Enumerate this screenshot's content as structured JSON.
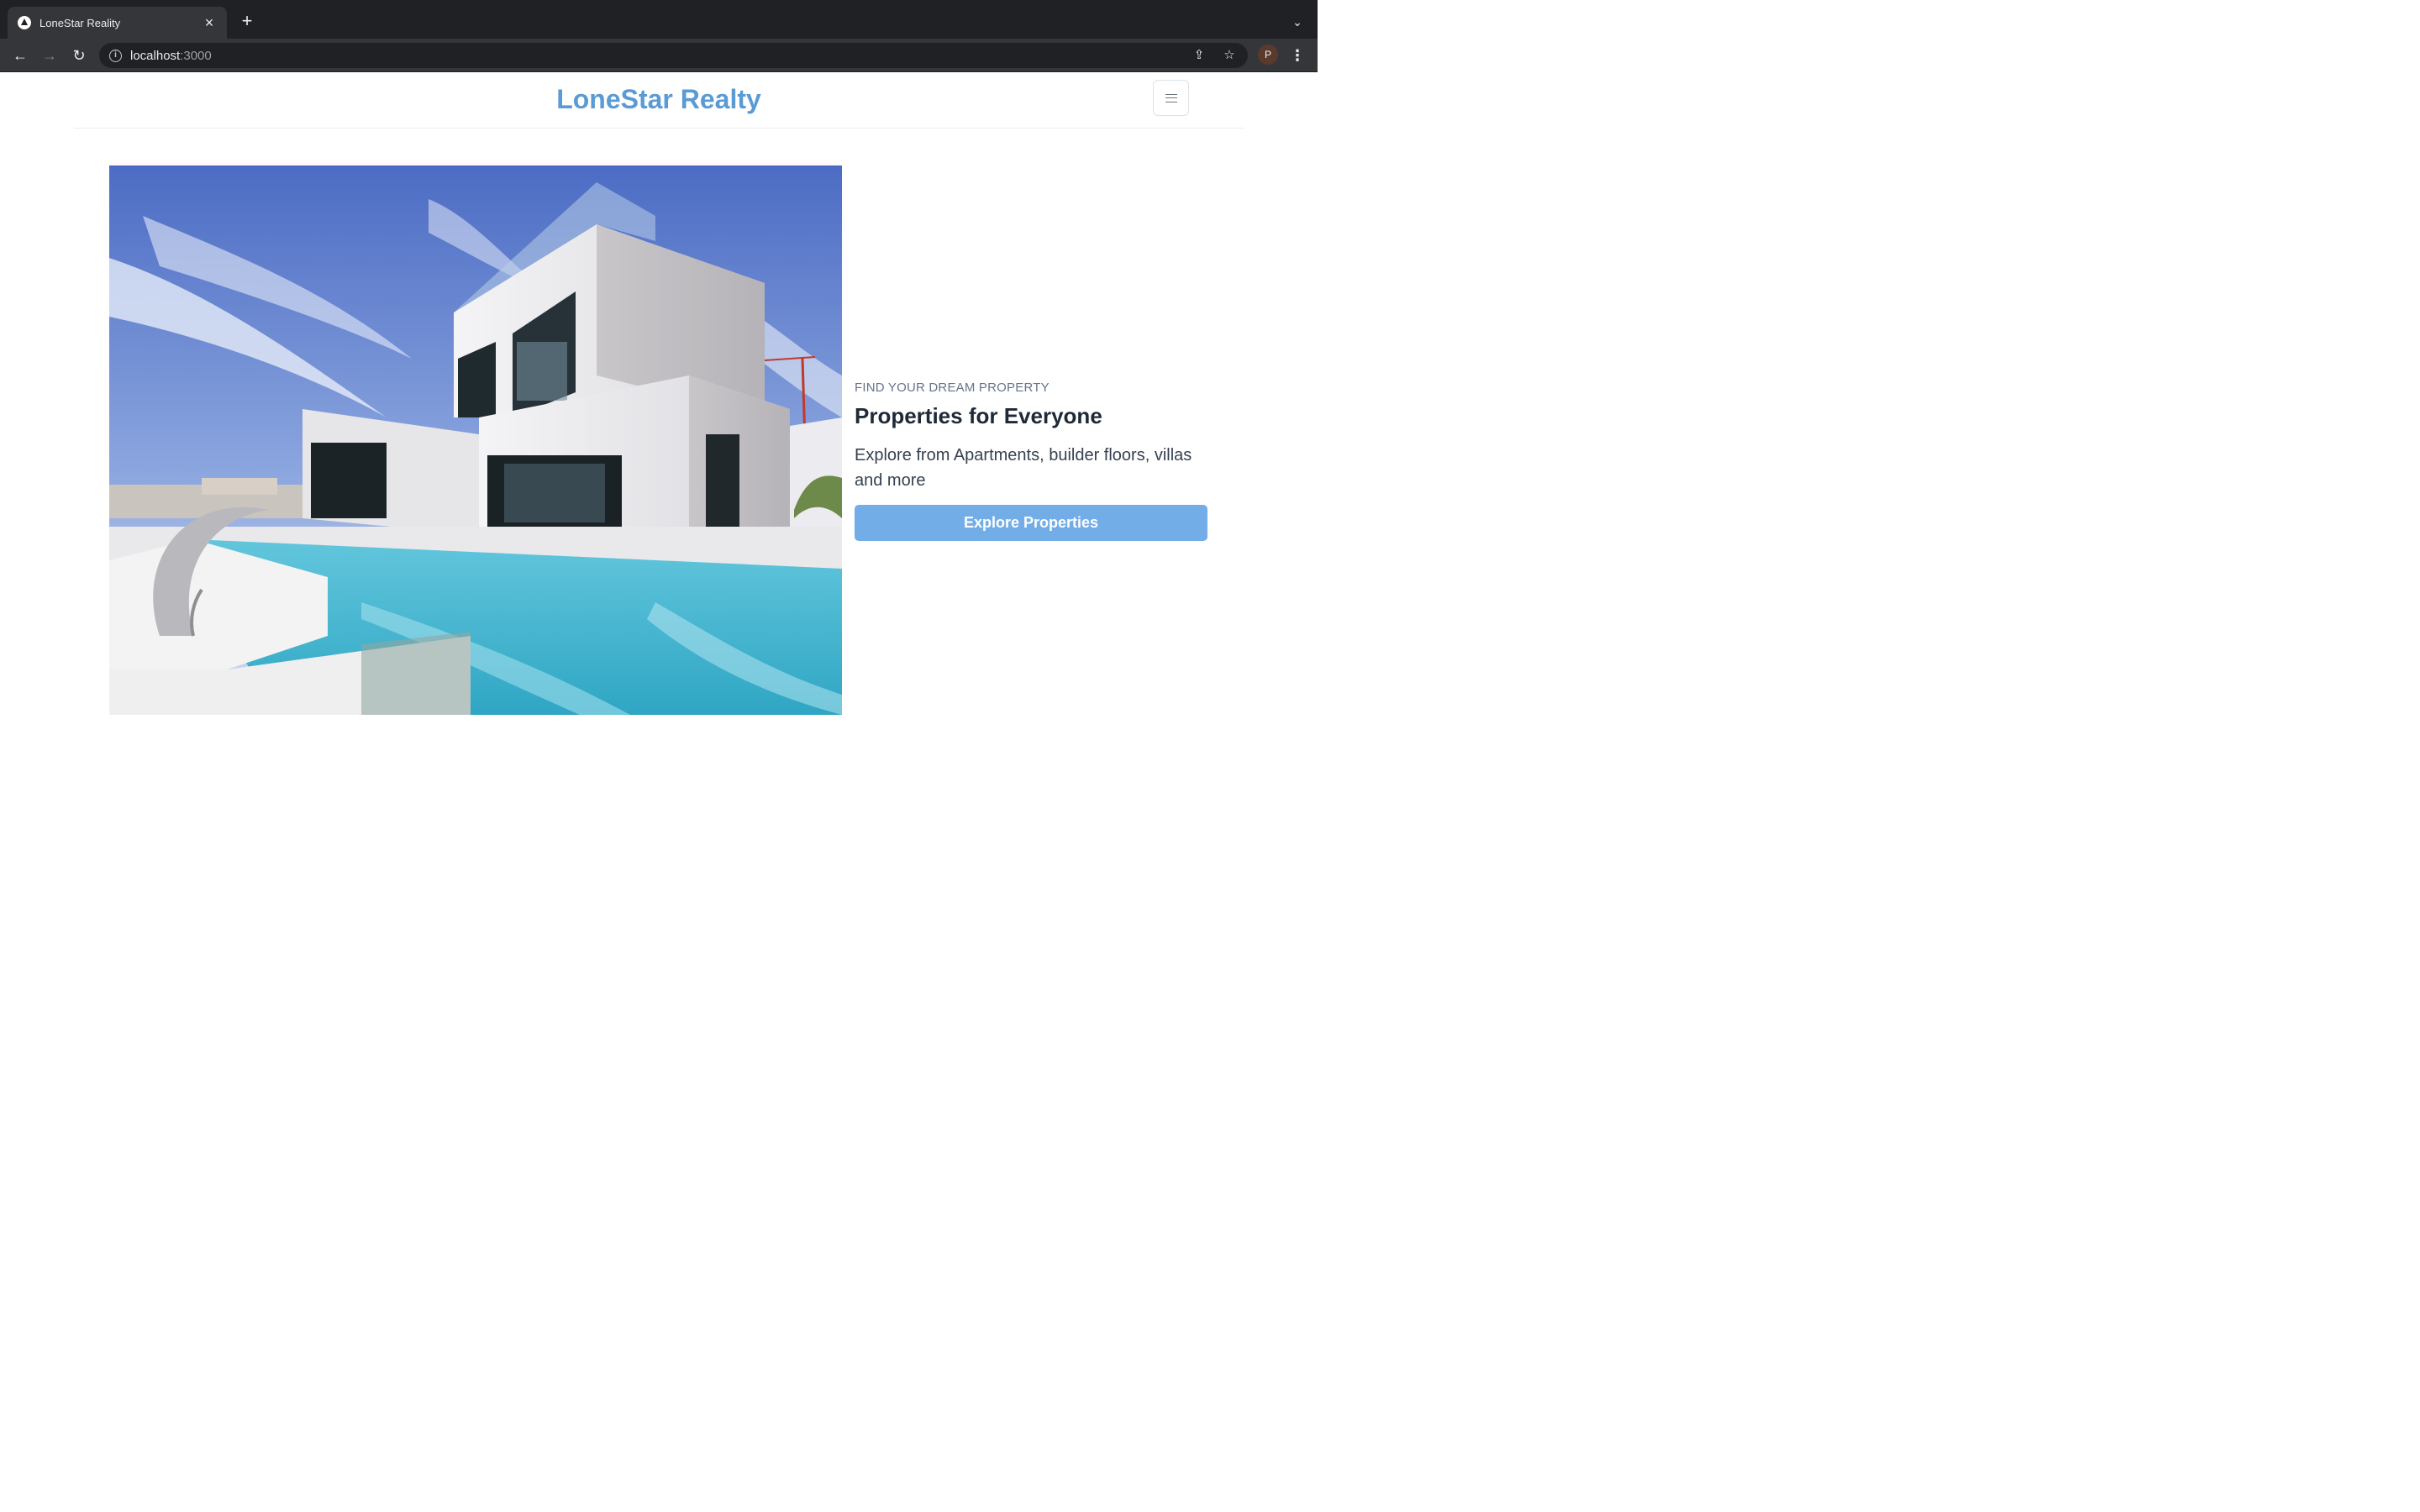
{
  "browser": {
    "tab_title": "LoneStar Reality",
    "url_host": "localhost",
    "url_port": ":3000",
    "profile_initial": "P"
  },
  "site": {
    "brand": "LoneStar Realty"
  },
  "hero": {
    "eyebrow": "FIND YOUR DREAM PROPERTY",
    "headline": "Properties for Everyone",
    "lead": "Explore from Apartments, builder floors, villas and more",
    "cta_label": "Explore Properties"
  },
  "colors": {
    "brand": "#5b9bd5",
    "cta": "#72ade8",
    "chrome_dark": "#202124",
    "chrome_tab": "#35363a"
  },
  "icons": {
    "back": "arrow-left-icon",
    "forward": "arrow-right-icon",
    "reload": "reload-icon",
    "info": "info-icon",
    "share": "share-icon",
    "bookmark": "star-icon",
    "menu": "hamburger-icon"
  }
}
